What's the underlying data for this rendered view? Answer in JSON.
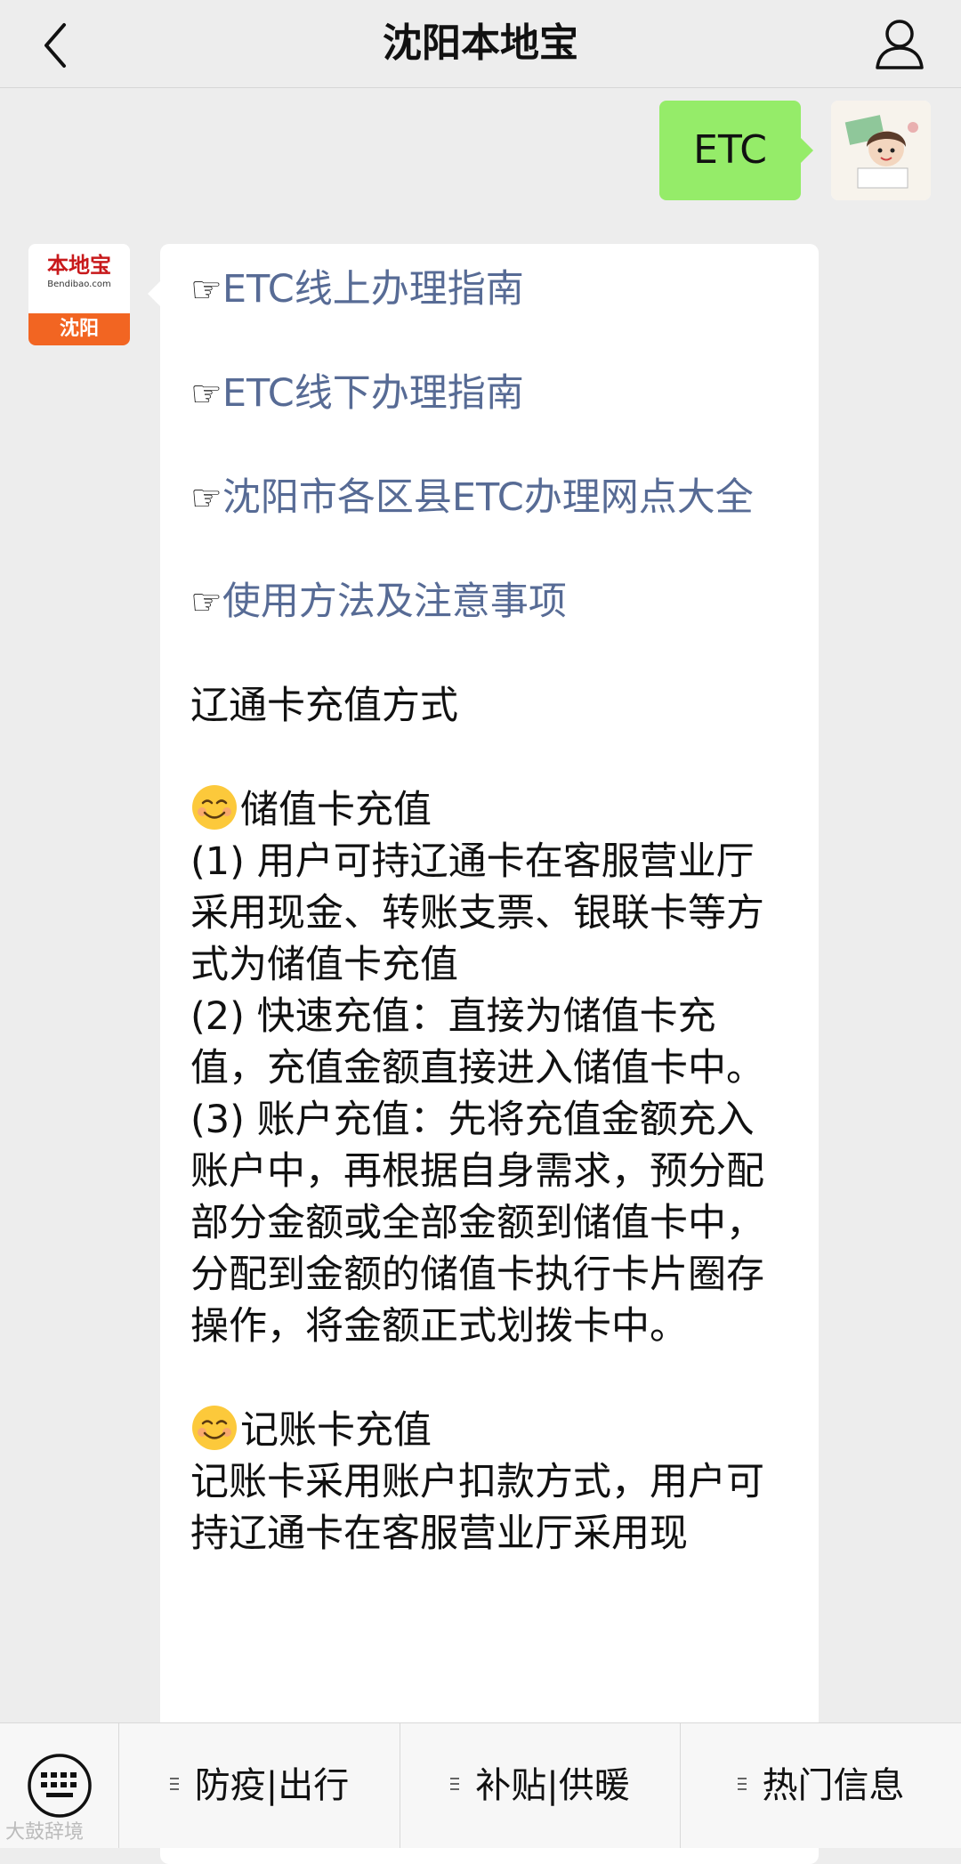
{
  "header": {
    "title": "沈阳本地宝"
  },
  "user_message": {
    "text": "ETC"
  },
  "bot_avatar": {
    "logo_cn": "本地宝",
    "logo_en": "Bendibao.com",
    "city": "沈阳"
  },
  "bot_message": {
    "hand": "☞",
    "links": [
      "ETC线上办理指南",
      "ETC线下办理指南",
      "沈阳市各区县ETC办理网点大全",
      "使用方法及注意事项"
    ],
    "section_title": "辽通卡充值方式",
    "stored_value": {
      "heading": "储值卡充值",
      "lines": [
        "(1) 用户可持辽通卡在客服营业厅采用现金、转账支票、银联卡等方式为储值卡充值",
        "(2) 快速充值：直接为储值卡充值，充值金额直接进入储值卡中。",
        "(3) 账户充值：先将充值金额充入账户中，再根据自身需求，预分配部分金额或全部金额到储值卡中，分配到金额的储值卡执行卡片圈存操作，将金额正式划拨卡中。"
      ]
    },
    "credit_card": {
      "heading": "记账卡充值",
      "text": "记账卡采用账户扣款方式，用户可持辽通卡在客服营业厅采用现"
    }
  },
  "bottom_menu": {
    "items": [
      "防疫|出行",
      "补贴|供暖",
      "热门信息"
    ]
  },
  "watermark": "大鼓辞境"
}
